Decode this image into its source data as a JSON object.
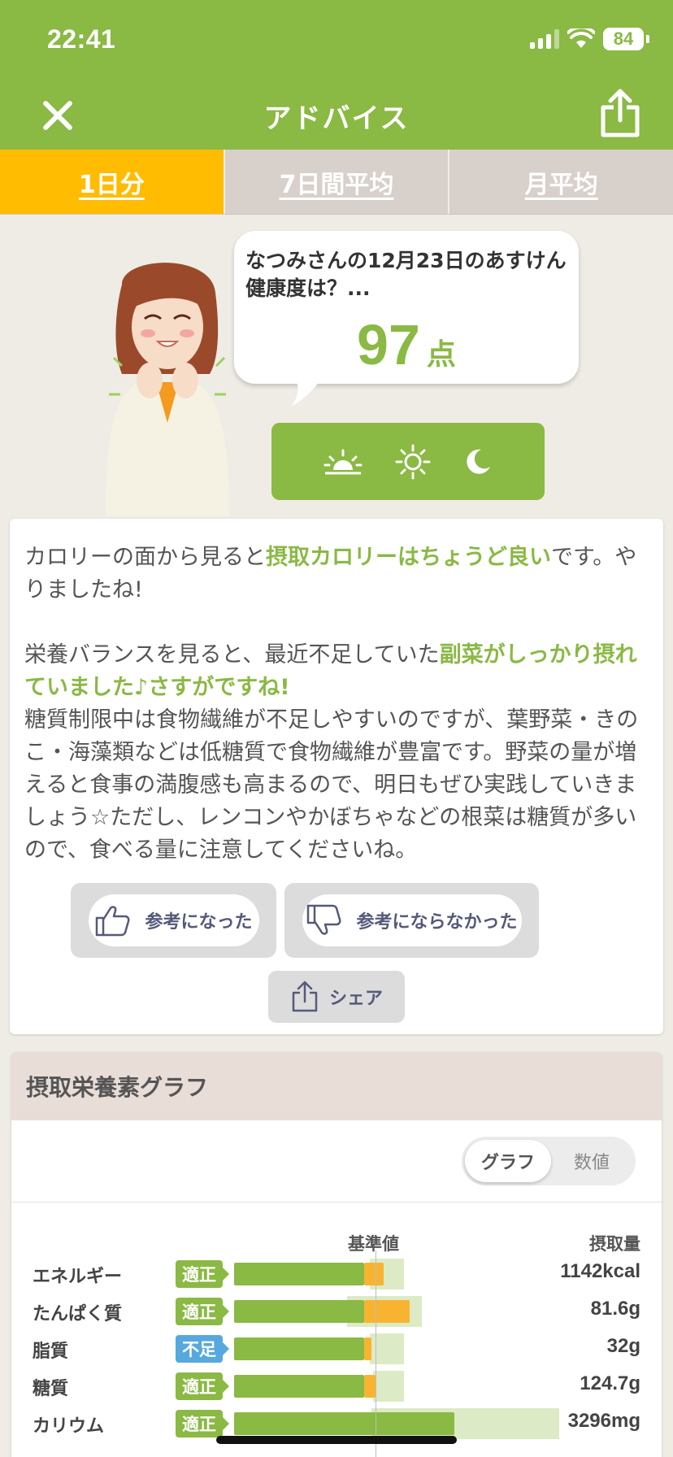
{
  "status_bar": {
    "time": "22:41",
    "battery": "84"
  },
  "header": {
    "title": "アドバイス"
  },
  "tabs": [
    {
      "label": "1日分",
      "active": true
    },
    {
      "label": "7日間平均",
      "active": false
    },
    {
      "label": "月平均",
      "active": false
    }
  ],
  "bubble": {
    "text": "なつみさんの12月23日のあすけん健康度は？...",
    "score": "97",
    "score_unit": "点"
  },
  "meal_icons": [
    "sunrise-icon",
    "sun-icon",
    "moon-icon"
  ],
  "advice": {
    "p1": [
      {
        "t": "カロリーの面から見ると",
        "hl": false
      },
      {
        "t": "摂取カロリーはちょうど良い",
        "hl": true
      },
      {
        "t": "です。やりましたね!",
        "hl": false
      }
    ],
    "p2": [
      {
        "t": "栄養バランスを見ると、最近不足していた",
        "hl": false
      },
      {
        "t": "副菜がしっかり摂れていました♪さすがですね!",
        "hl": true
      }
    ],
    "p3": "糖質制限中は食物繊維が不足しやすいのですが、葉野菜・きのこ・海藻類などは低糖質で食物繊維が豊富です。野菜の量が増えると食事の満腹感も高まるので、明日もぜひ実践していきましょう☆ただし、レンコンやかぼちゃなどの根菜は糖質が多いので、食べる量に注意してくださいね。",
    "helpful_label": "参考になった",
    "not_helpful_label": "参考にならなかった",
    "share_label": "シェア"
  },
  "graph": {
    "title": "摂取栄養素グラフ",
    "toggle_graph": "グラフ",
    "toggle_values": "数値",
    "header_base": "基準値",
    "header_amount": "摂取量",
    "rows": [
      {
        "label": "エネルギー",
        "status": "適正",
        "status_type": "ok",
        "value": "1142kcal",
        "fill_ratio": 1.06,
        "range": [
          0.96,
          1.2
        ]
      },
      {
        "label": "たんぱく質",
        "status": "適正",
        "status_type": "ok",
        "value": "81.6g",
        "fill_ratio": 1.24,
        "range": [
          0.8,
          1.33
        ]
      },
      {
        "label": "脂質",
        "status": "不足",
        "status_type": "low",
        "value": "32g",
        "fill_ratio": 0.97,
        "range": [
          0.96,
          1.2
        ]
      },
      {
        "label": "糖質",
        "status": "適正",
        "status_type": "ok",
        "value": "124.7g",
        "fill_ratio": 1.0,
        "range": [
          0.98,
          1.2
        ]
      },
      {
        "label": "カリウム",
        "status": "適正",
        "status_type": "ok",
        "value": "3296mg",
        "fill_ratio": 1.56,
        "range": [
          0.97,
          2.3
        ]
      }
    ],
    "colors": {
      "green": "#8ab944",
      "orange": "#f8b431",
      "track": "#dcebc5",
      "low": "#56a9de"
    }
  }
}
